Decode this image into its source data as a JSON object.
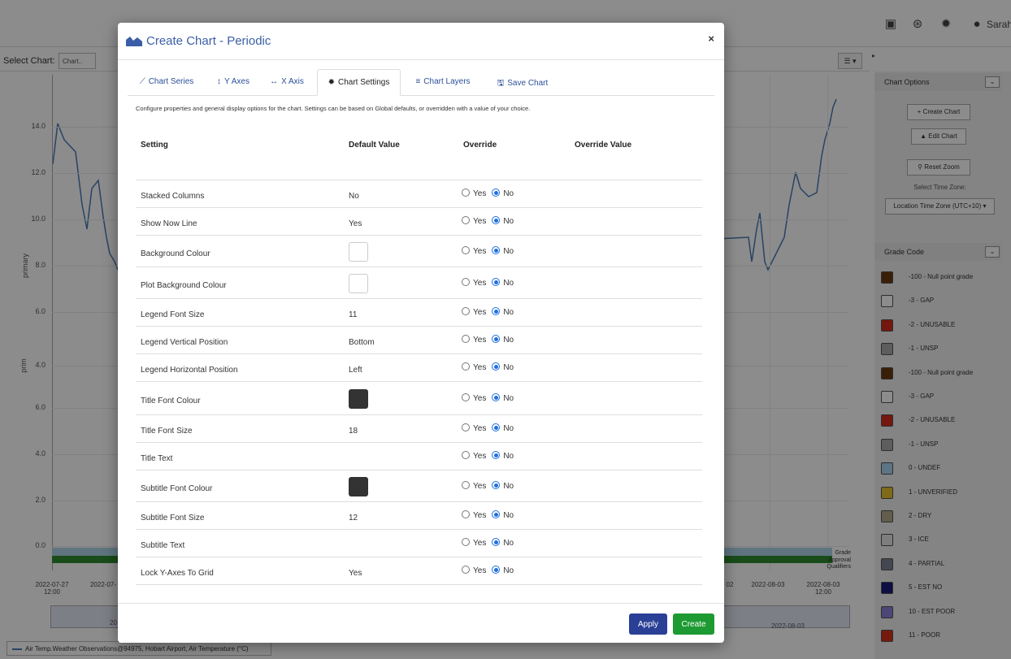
{
  "app": {
    "user_name": "Sarah",
    "select_chart_label": "Select Chart:",
    "select_chart_value": "Chart..",
    "y_axis_ticks": [
      "14.0",
      "12.0",
      "10.0",
      "8.0",
      "6.0",
      "4.0",
      "6.0",
      "4.0",
      "2.0",
      "0.0"
    ],
    "y_axis_labels": [
      "primary",
      "prim"
    ],
    "band_labels": [
      "Grade",
      "Approval",
      "Qualifiers"
    ],
    "x_axis_ticks_left": [
      "2022-07-27\n12:00",
      "2022-07-"
    ],
    "x_axis_ticks_right": [
      "02",
      "2022-08-03",
      "2022-08-03\n12:00"
    ],
    "navigator_dates": [
      "20",
      "2022-08-03"
    ],
    "legend_text": "Air Temp.Weather Observations@94975, Hobart Airport, Air Temperature (°C)"
  },
  "side_panel": {
    "chart_options_title": "Chart Options",
    "create_chart_label": "+ Create Chart",
    "edit_chart_label": "Edit Chart",
    "reset_zoom_label": "Reset Zoom",
    "select_timezone_label": "Select Time Zone:",
    "timezone_value": "Location Time Zone (UTC+10)",
    "grade_code_title": "Grade Code",
    "grades": [
      {
        "label": "-100 - Null point grade",
        "color": "#6b3a10"
      },
      {
        "label": "-3 - GAP",
        "color": "#ffffff"
      },
      {
        "label": "-2 - UNUSABLE",
        "color": "#d42a1a"
      },
      {
        "label": "-1 - UNSP",
        "color": "#aaaaaa"
      },
      {
        "label": "-100 - Null point grade",
        "color": "#6b3a10"
      },
      {
        "label": "-3 - GAP",
        "color": "#ffffff"
      },
      {
        "label": "-2 - UNUSABLE",
        "color": "#d42a1a"
      },
      {
        "label": "-1 - UNSP",
        "color": "#aaaaaa"
      },
      {
        "label": "0 - UNDEF",
        "color": "#a8d4ee"
      },
      {
        "label": "1 - UNVERIFIED",
        "color": "#e6c22a"
      },
      {
        "label": "2 - DRY",
        "color": "#b2a98a"
      },
      {
        "label": "3 - ICE",
        "color": "#e6e6e6"
      },
      {
        "label": "4 - PARTIAL",
        "color": "#7a8190"
      },
      {
        "label": "5 - EST NO",
        "color": "#1a1a78"
      },
      {
        "label": "10 - EST POOR",
        "color": "#8c82d6"
      },
      {
        "label": "11 - POOR",
        "color": "#d4321a"
      }
    ]
  },
  "modal": {
    "title": "Create Chart - Periodic",
    "close_label": "×",
    "tabs": [
      {
        "label": "Chart Series",
        "icon": "line-chart-icon"
      },
      {
        "label": "Y Axes",
        "icon": "vertical-arrows-icon"
      },
      {
        "label": "X Axis",
        "icon": "horizontal-arrows-icon"
      },
      {
        "label": "Chart Settings",
        "icon": "gear-icon"
      },
      {
        "label": "Chart Layers",
        "icon": "list-icon"
      },
      {
        "label": "Save Chart",
        "icon": "save-icon"
      }
    ],
    "active_tab": "Chart Settings",
    "description": "Configure properties and general display options for the chart. Settings can be based on Global defaults, or overridden with a value of your choice.",
    "columns": [
      "Setting",
      "Default Value",
      "Override",
      "Override Value"
    ],
    "yes_label": "Yes",
    "no_label": "No",
    "rows": [
      {
        "setting": "Stacked Columns",
        "default": "No",
        "type": "text",
        "override": "No"
      },
      {
        "setting": "Show Now Line",
        "default": "Yes",
        "type": "text",
        "override": "No"
      },
      {
        "setting": "Background Colour",
        "default": "",
        "type": "color",
        "color": "#ffffff",
        "override": "No"
      },
      {
        "setting": "Plot Background Colour",
        "default": "",
        "type": "color",
        "color": "#ffffff",
        "override": "No"
      },
      {
        "setting": "Legend Font Size",
        "default": "11",
        "type": "text",
        "override": "No"
      },
      {
        "setting": "Legend Vertical Position",
        "default": "Bottom",
        "type": "text",
        "override": "No"
      },
      {
        "setting": "Legend Horizontal Position",
        "default": "Left",
        "type": "text",
        "override": "No"
      },
      {
        "setting": "Title Font Colour",
        "default": "",
        "type": "color",
        "color": "#333333",
        "override": "No"
      },
      {
        "setting": "Title Font Size",
        "default": "18",
        "type": "text",
        "override": "No"
      },
      {
        "setting": "Title Text",
        "default": "",
        "type": "text",
        "override": "No"
      },
      {
        "setting": "Subtitle Font Colour",
        "default": "",
        "type": "color",
        "color": "#333333",
        "override": "No"
      },
      {
        "setting": "Subtitle Font Size",
        "default": "12",
        "type": "text",
        "override": "No"
      },
      {
        "setting": "Subtitle Text",
        "default": "",
        "type": "text",
        "override": "No"
      },
      {
        "setting": "Lock Y-Axes To Grid",
        "default": "Yes",
        "type": "text",
        "override": "No"
      }
    ],
    "apply_label": "Apply",
    "create_label": "Create"
  }
}
